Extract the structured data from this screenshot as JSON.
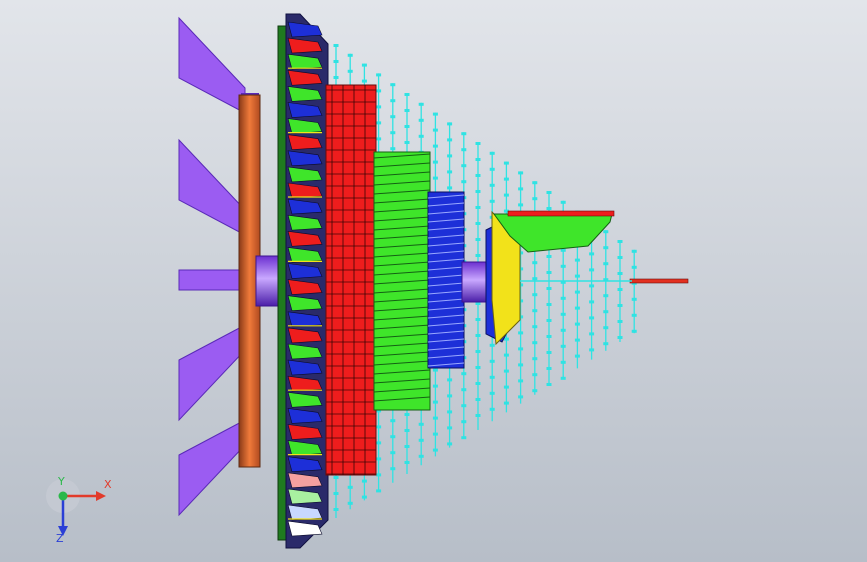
{
  "viewport": {
    "background_top": "#e2e5ea",
    "background_bottom": "#b7bec8"
  },
  "model": {
    "purple": "#9b5cf2",
    "purple_dark": "#5a2ab8",
    "orange": "#e0652b",
    "orange_dark": "#8a3a18",
    "red": "#ee1d1d",
    "green": "#3fe52a",
    "blue": "#1d2fd8",
    "yellow": "#f2e21a",
    "cyan": "#2fe3e3",
    "dark_green": "#1f7a1f"
  },
  "triad": {
    "x_label": "X",
    "y_label": "Y",
    "z_label": "Z",
    "x_color": "#e23a2a",
    "y_color": "#2bb84a",
    "z_color": "#2a3fd6"
  }
}
